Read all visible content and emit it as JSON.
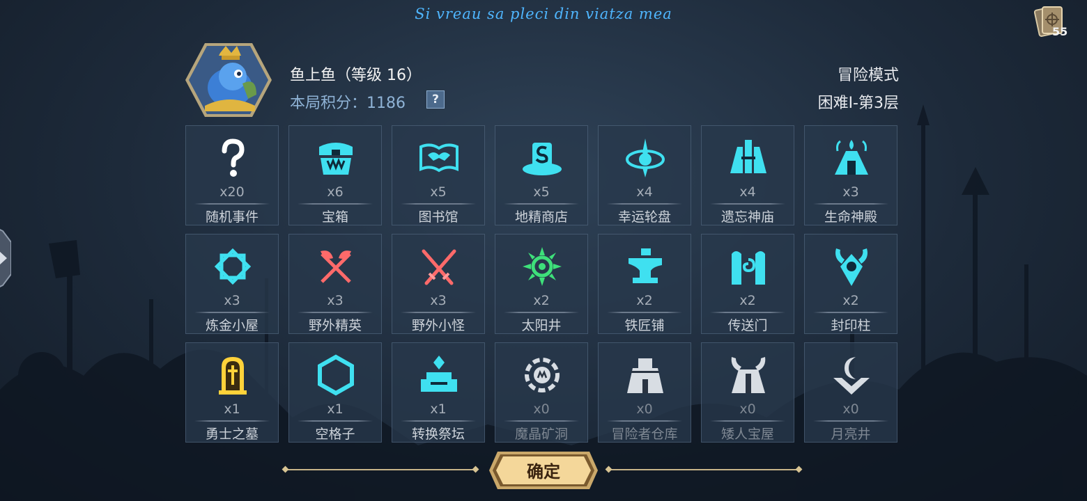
{
  "banner": "Si vreau sa pleci din viatza mea",
  "deck": {
    "count": "55",
    "icon": "card-deck-icon"
  },
  "player": {
    "name": "鱼上鱼（等级 16）",
    "score_label": "本局积分：1186",
    "help": "?"
  },
  "mode": {
    "name": "冒险模式",
    "difficulty": "困难Ⅰ-第3层"
  },
  "colors": {
    "cyan": "#3fe0f0",
    "red": "#ff5a5a",
    "green": "#3ee07a",
    "gold": "#ffd23a",
    "dim": "#d8dde3"
  },
  "tiles": [
    {
      "count": "x20",
      "name": "随机事件",
      "icon": "question-icon"
    },
    {
      "count": "x6",
      "name": "宝箱",
      "icon": "treasure-chest-icon"
    },
    {
      "count": "x5",
      "name": "图书馆",
      "icon": "open-book-icon"
    },
    {
      "count": "x5",
      "name": "地精商店",
      "icon": "goblin-shop-icon"
    },
    {
      "count": "x4",
      "name": "幸运轮盘",
      "icon": "lucky-wheel-icon"
    },
    {
      "count": "x4",
      "name": "遗忘神庙",
      "icon": "forgotten-temple-icon"
    },
    {
      "count": "x3",
      "name": "生命神殿",
      "icon": "life-temple-icon"
    },
    {
      "count": "x3",
      "name": "炼金小屋",
      "icon": "alchemy-hut-icon"
    },
    {
      "count": "x3",
      "name": "野外精英",
      "icon": "crossed-axes-icon"
    },
    {
      "count": "x3",
      "name": "野外小怪",
      "icon": "crossed-swords-icon"
    },
    {
      "count": "x2",
      "name": "太阳井",
      "icon": "sun-well-icon"
    },
    {
      "count": "x2",
      "name": "铁匠铺",
      "icon": "anvil-icon"
    },
    {
      "count": "x2",
      "name": "传送门",
      "icon": "portal-icon"
    },
    {
      "count": "x2",
      "name": "封印柱",
      "icon": "seal-pillar-icon"
    },
    {
      "count": "x1",
      "name": "勇士之墓",
      "icon": "tombstone-icon"
    },
    {
      "count": "x1",
      "name": "空格子",
      "icon": "empty-hexagon-icon"
    },
    {
      "count": "x1",
      "name": "转换祭坛",
      "icon": "altar-icon"
    },
    {
      "count": "x0",
      "name": "魔晶矿洞",
      "icon": "crystal-mine-icon"
    },
    {
      "count": "x0",
      "name": "冒险者仓库",
      "icon": "warehouse-icon"
    },
    {
      "count": "x0",
      "name": "矮人宝屋",
      "icon": "dwarf-treasury-icon"
    },
    {
      "count": "x0",
      "name": "月亮井",
      "icon": "moon-well-icon"
    }
  ],
  "confirm": "确定"
}
